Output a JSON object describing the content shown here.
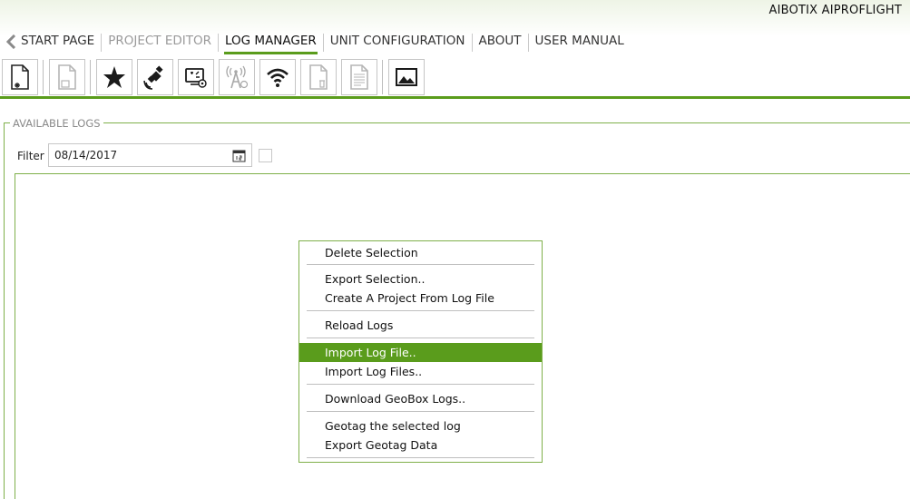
{
  "app_title": "AIBOTIX AIPROFLIGHT",
  "nav": {
    "items": [
      {
        "label": "START PAGE",
        "state": "normal"
      },
      {
        "label": "PROJECT EDITOR",
        "state": "disabled"
      },
      {
        "label": "LOG MANAGER",
        "state": "active"
      },
      {
        "label": "UNIT CONFIGURATION",
        "state": "normal"
      },
      {
        "label": "ABOUT",
        "state": "normal"
      },
      {
        "label": "USER MANUAL",
        "state": "normal"
      }
    ]
  },
  "toolbar": {
    "buttons": [
      {
        "icon": "new-file-icon",
        "enabled": true
      },
      {
        "icon": "save-file-icon",
        "enabled": false
      },
      {
        "icon": "star-icon",
        "enabled": true
      },
      {
        "icon": "satellite-icon",
        "enabled": true
      },
      {
        "icon": "device-settings-icon",
        "enabled": true
      },
      {
        "icon": "antenna-settings-icon",
        "enabled": false
      },
      {
        "icon": "wifi-icon",
        "enabled": true
      },
      {
        "icon": "delete-file-icon",
        "enabled": false
      },
      {
        "icon": "document-icon",
        "enabled": false
      },
      {
        "icon": "image-icon",
        "enabled": true
      }
    ]
  },
  "available_logs": {
    "legend": "AVAILABLE LOGS",
    "filter_label": "Filter",
    "filter_date": "08/14/2017",
    "filter_checkbox_checked": false
  },
  "context_menu": {
    "items": [
      {
        "label": "Delete Selection"
      },
      {
        "label": "Export Selection.."
      },
      {
        "label": "Create A Project From Log File"
      },
      {
        "label": "Reload Logs"
      },
      {
        "label": "Import Log File..",
        "highlighted": true
      },
      {
        "label": "Import Log Files.."
      },
      {
        "label": "Download GeoBox Logs.."
      },
      {
        "label": "Geotag the selected log"
      },
      {
        "label": "Export Geotag Data"
      }
    ]
  },
  "colors": {
    "accent": "#5a9c1c",
    "border_green": "#7fb04a",
    "disabled_text": "#9a9a9a"
  }
}
